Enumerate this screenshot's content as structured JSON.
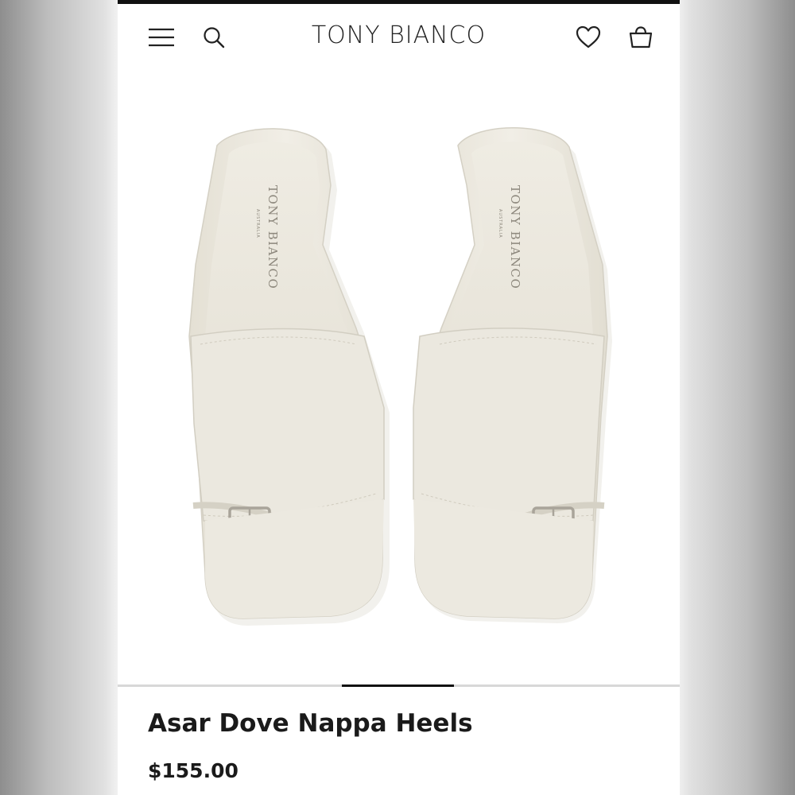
{
  "header": {
    "brand": "TONY BIANCO",
    "menu_icon": "hamburger-menu-icon",
    "search_icon": "search-icon",
    "wishlist_icon": "heart-icon",
    "bag_icon": "shopping-bag-icon"
  },
  "product": {
    "title": "Asar Dove Nappa Heels",
    "price": "$155.00",
    "insole_logo_brand": "TONY BIANCO",
    "insole_logo_sub": "AUSTRALIA"
  },
  "carousel": {
    "active_index": 2,
    "total": 5
  },
  "colors": {
    "text": "#1a1a1a",
    "shoe": "#ece9df",
    "accent_bar": "#111111"
  }
}
